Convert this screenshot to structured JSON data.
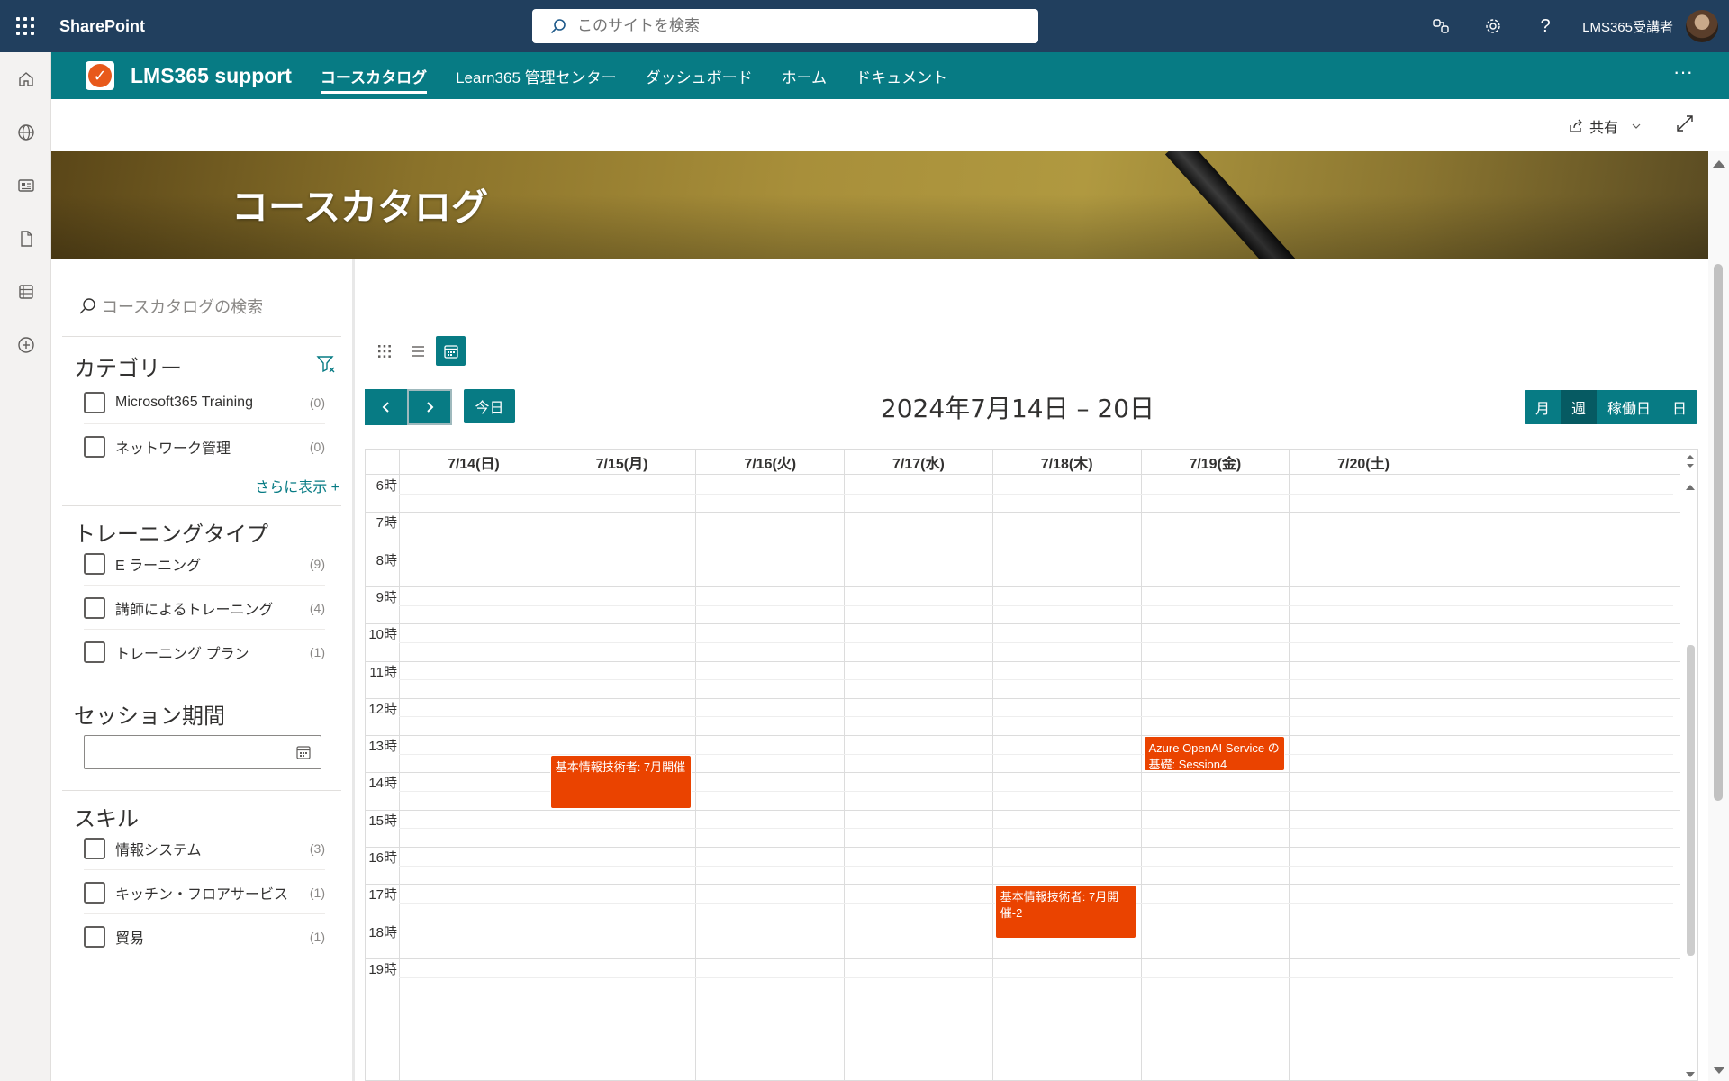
{
  "suitebar": {
    "brand": "SharePoint",
    "search_placeholder": "このサイトを検索",
    "user_name": "LMS365受講者"
  },
  "hubnav": {
    "site_title": "LMS365 support",
    "links": [
      "コースカタログ",
      "Learn365 管理センター",
      "ダッシュボード",
      "ホーム",
      "ドキュメント"
    ],
    "more": "···"
  },
  "cmdbar": {
    "share_label": "共有"
  },
  "banner": {
    "title": "コースカタログ"
  },
  "filters": {
    "search_placeholder": "コースカタログの検索",
    "category": {
      "heading": "カテゴリー",
      "items": [
        {
          "label": "Microsoft365 Training",
          "count": "(0)"
        },
        {
          "label": "ネットワーク管理",
          "count": "(0)"
        }
      ],
      "more": "さらに表示 +"
    },
    "training_type": {
      "heading": "トレーニングタイプ",
      "items": [
        {
          "label": "E ラーニング",
          "count": "(9)"
        },
        {
          "label": "講師によるトレーニング",
          "count": "(4)"
        },
        {
          "label": "トレーニング プラン",
          "count": "(1)"
        }
      ]
    },
    "session_period": {
      "heading": "セッション期間"
    },
    "skills": {
      "heading": "スキル",
      "items": [
        {
          "label": "情報システム",
          "count": "(3)"
        },
        {
          "label": "キッチン・フロアサービス",
          "count": "(1)"
        },
        {
          "label": "貿易",
          "count": "(1)"
        }
      ]
    }
  },
  "calendar": {
    "today_label": "今日",
    "title": "2024年7月14日 – 20日",
    "range_buttons": [
      "月",
      "週",
      "稼働日",
      "日"
    ],
    "active_range": "週",
    "days": [
      "7/14(日)",
      "7/15(月)",
      "7/16(火)",
      "7/17(水)",
      "7/18(木)",
      "7/19(金)",
      "7/20(土)"
    ],
    "hours": [
      "6時",
      "7時",
      "8時",
      "9時",
      "10時",
      "11時",
      "12時",
      "13時",
      "14時",
      "15時",
      "16時",
      "17時",
      "18時",
      "19時"
    ],
    "events": [
      {
        "title": "基本情報技術者: 7月開催",
        "day": 1,
        "start": 13.5,
        "end": 15.0
      },
      {
        "title": "Azure OpenAI Service の基礎: Session4",
        "day": 5,
        "start": 13.0,
        "end": 14.0
      },
      {
        "title": "基本情報技術者: 7月開催-2",
        "day": 4,
        "start": 17.0,
        "end": 18.5
      }
    ],
    "event_color": "#ea4300"
  },
  "colors": {
    "suitebar": "#213f5e",
    "accent": "#077b84"
  }
}
